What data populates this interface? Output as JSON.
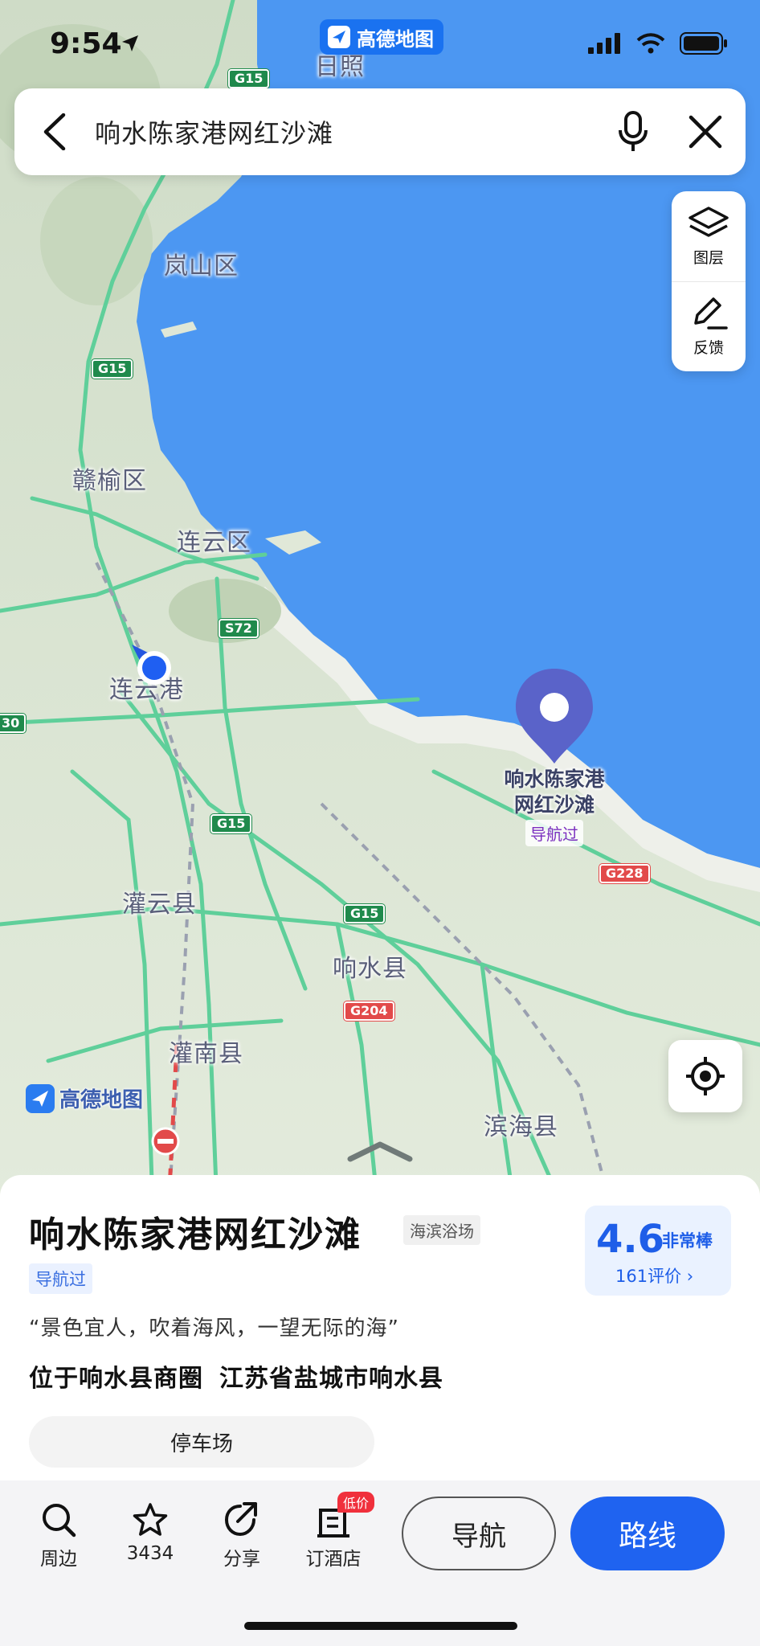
{
  "status_bar": {
    "time": "9:54",
    "app_badge": "高德地图"
  },
  "search": {
    "query": "响水陈家港网红沙滩"
  },
  "map_tools": {
    "layers_label": "图层",
    "feedback_label": "反馈"
  },
  "map": {
    "places": [
      "日照",
      "岚山区",
      "赣榆区",
      "连云区",
      "连云港",
      "灌云县",
      "响水县",
      "灌南县",
      "滨海县"
    ],
    "shields": [
      "G15",
      "G15",
      "S72",
      "G15",
      "G15",
      "G204",
      "G228",
      "30"
    ],
    "logo": "高德地图",
    "poi_label_line1": "响水陈家港",
    "poi_label_line2": "网红沙滩",
    "poi_tag": "导航过"
  },
  "poi": {
    "title": "响水陈家港网红沙滩",
    "category": "海滨浴场",
    "visited_tag": "导航过",
    "rating": "4.6",
    "rating_word": "非常棒",
    "reviews": "161评价 ›",
    "quote": "“景色宜人，吹着海风，一望无际的海”",
    "area": "位于响水县商圈",
    "address": "江苏省盐城市响水县",
    "chip": "停车场"
  },
  "actions": {
    "nearby": "周边",
    "favorites": "3434",
    "share": "分享",
    "hotel": "订酒店",
    "hotel_promo": "低价",
    "navigate": "导航",
    "route": "路线"
  },
  "colors": {
    "sea": "#4c97f2",
    "land": "#dde8d6",
    "accent": "#1f63f0"
  }
}
